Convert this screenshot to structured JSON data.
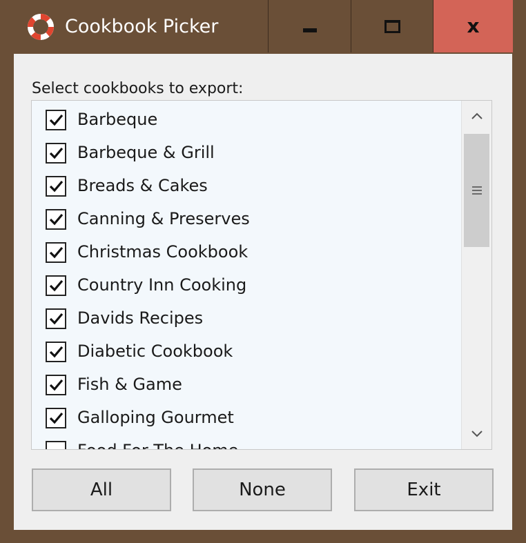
{
  "window": {
    "title": "Cookbook Picker",
    "icon": "lifebuoy-icon",
    "controls": {
      "minimize_icon": "minimize-icon",
      "maximize_icon": "maximize-icon",
      "close_glyph": "x"
    },
    "colors": {
      "frame": "#6a4f37",
      "close_button": "#d36457",
      "list_background": "#f3f8fc"
    }
  },
  "main": {
    "prompt": "Select cookbooks to export:",
    "cookbooks": [
      {
        "label": "Barbeque",
        "checked": true
      },
      {
        "label": "Barbeque & Grill",
        "checked": true
      },
      {
        "label": "Breads & Cakes",
        "checked": true
      },
      {
        "label": "Canning & Preserves",
        "checked": true
      },
      {
        "label": "Christmas Cookbook",
        "checked": true
      },
      {
        "label": "Country Inn Cooking",
        "checked": true
      },
      {
        "label": "Davids Recipes",
        "checked": true
      },
      {
        "label": "Diabetic Cookbook",
        "checked": true
      },
      {
        "label": "Fish & Game",
        "checked": true
      },
      {
        "label": "Galloping Gourmet",
        "checked": true
      },
      {
        "label": "Food For The Home",
        "checked": false
      }
    ]
  },
  "buttons": {
    "all": "All",
    "none": "None",
    "exit": "Exit"
  }
}
